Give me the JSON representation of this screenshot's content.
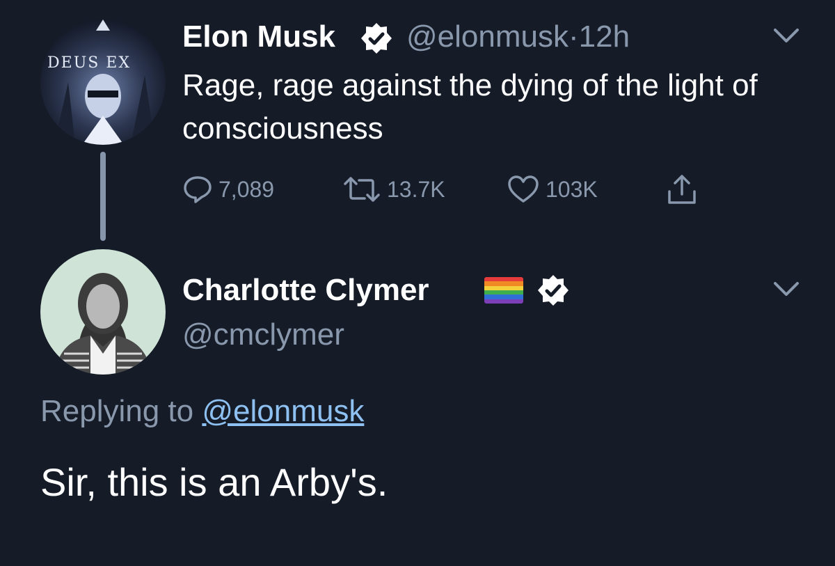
{
  "tweet": {
    "author_name": "Elon Musk",
    "author_handle": "@elonmusk",
    "separator": "·",
    "time": "12h",
    "text": "Rage, rage against the dying of the light of consciousness",
    "avatar_text": "DEUS EX",
    "stats": {
      "replies": "7,089",
      "retweets": "13.7K",
      "likes": "103K"
    }
  },
  "reply": {
    "author_name": "Charlotte Clymer",
    "author_handle": "@cmclymer",
    "replying_to_label": "Replying to",
    "replying_to_handle": "@elonmusk",
    "text": "Sir, this is an Arby's."
  },
  "icons": {
    "reply": "reply-icon",
    "retweet": "retweet-icon",
    "like": "heart-icon",
    "share": "share-icon",
    "verified": "verified-badge-icon",
    "menu": "chevron-down-icon",
    "flag": "rainbow-flag-icon"
  },
  "colors": {
    "background": "#151c28",
    "text": "#ffffff",
    "muted": "#8a98ad",
    "link": "#8ec1f2"
  }
}
